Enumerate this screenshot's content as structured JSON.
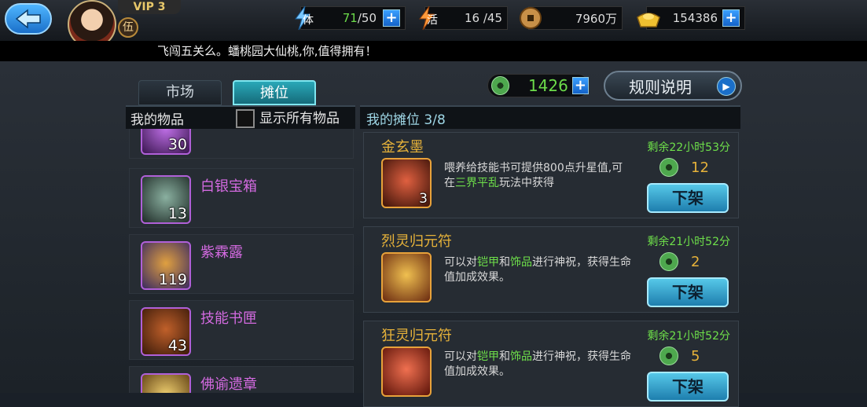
{
  "header": {
    "vip_label": "VIP 3",
    "rank_char": "伍",
    "resources": [
      {
        "name": "stamina",
        "icon_char": "体",
        "current": "71",
        "max": "/50",
        "has_plus": true
      },
      {
        "name": "activity",
        "icon_char": "活",
        "value": "16 /45",
        "has_plus": false
      },
      {
        "name": "copper",
        "value": "7960万",
        "has_plus": false
      },
      {
        "name": "gold",
        "value": "154386",
        "has_plus": true
      }
    ]
  },
  "ticker": {
    "text": "飞闯五关么。蟠桃园大仙桃,你,值得拥有！"
  },
  "tabs": [
    {
      "label": "市场",
      "active": false
    },
    {
      "label": "摊位",
      "active": true
    }
  ],
  "currency": {
    "jade": "1426"
  },
  "rules_button": "规则说明",
  "my_items": {
    "title": "我的物品",
    "show_all_label": "显示所有物品",
    "items": [
      {
        "name": "",
        "qty": "30"
      },
      {
        "name": "白银宝箱",
        "qty": "13"
      },
      {
        "name": "紫霖露",
        "qty": "119"
      },
      {
        "name": "技能书匣",
        "qty": "43"
      },
      {
        "name": "佛谕遗章",
        "qty": ""
      }
    ]
  },
  "my_stall": {
    "title": "我的摊位 3/8",
    "listings": [
      {
        "name": "金玄墨",
        "qty": "3",
        "desc_parts": [
          "喂养给技能书可提供800点升星值,可在",
          "三界平乱",
          "玩法中获得"
        ],
        "timer": "剩余22小时53分",
        "price": "12",
        "button": "下架"
      },
      {
        "name": "烈灵归元符",
        "qty": "",
        "desc_parts": [
          "可以对",
          "铠甲",
          "和",
          "饰品",
          "进行神祝，获得生命值加成效果。"
        ],
        "timer": "剩余21小时52分",
        "price": "2",
        "button": "下架"
      },
      {
        "name": "狂灵归元符",
        "qty": "",
        "desc_parts": [
          "可以对",
          "铠甲",
          "和",
          "饰品",
          "进行神祝，获得生命值加成效果。"
        ],
        "timer": "剩余21小时52分",
        "price": "5",
        "button": "下架"
      }
    ]
  },
  "colors": {
    "accent_green": "#6ee04a",
    "title_gold": "#e6b23a",
    "item_purple": "#d36ae0"
  }
}
